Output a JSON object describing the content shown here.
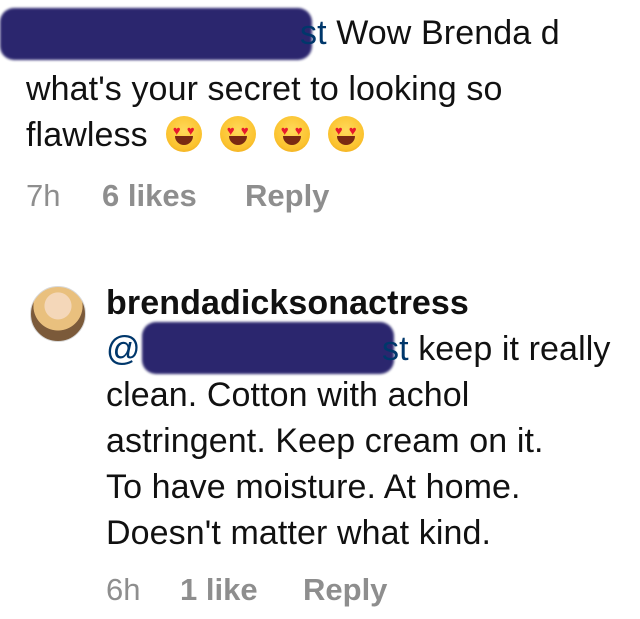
{
  "comments": [
    {
      "mention_visible": "st",
      "lines": [
        "Wow Brenda d",
        "what's your secret to looking so",
        "flawless"
      ],
      "emojis": [
        "heart-eyes-emoji",
        "heart-eyes-emoji",
        "heart-eyes-emoji",
        "heart-eyes-emoji"
      ],
      "time": "7h",
      "likes": "6 likes",
      "reply": "Reply"
    },
    {
      "username": "brendadicksonactress",
      "mention_prefix": "@",
      "mention_visible": "st",
      "lines": [
        "keep it really",
        "clean. Cotton with achol",
        "astringent.  Keep cream on it.",
        "To have moisture. At home.",
        "Doesn't matter what kind."
      ],
      "time": "6h",
      "likes": "1 like",
      "reply": "Reply"
    }
  ]
}
